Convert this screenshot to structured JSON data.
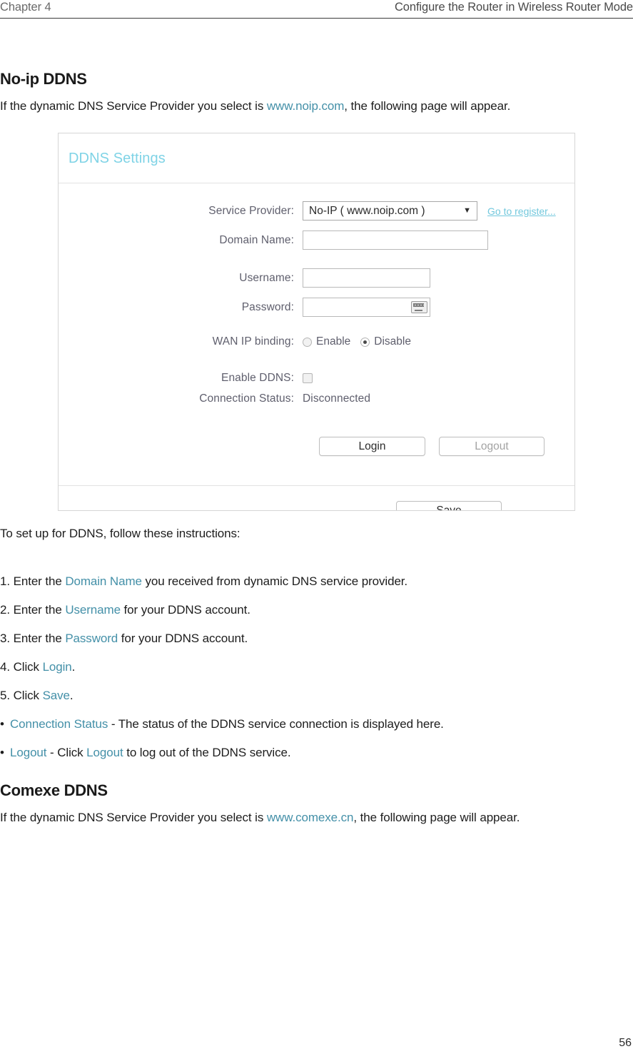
{
  "header": {
    "chapter": "Chapter 4",
    "doc_title": "Configure the Router in Wireless Router Mode"
  },
  "sections": [
    {
      "heading": "No-ip DDNS",
      "intro_before": "If the dynamic DNS Service Provider you select is ",
      "intro_link": "www.noip.com",
      "intro_after": ", the following page will appear."
    },
    {
      "heading": "Comexe DDNS",
      "intro_before": "If the dynamic DNS Service Provider you select is ",
      "intro_link": "www.comexe.cn",
      "intro_after": ", the following page will appear."
    }
  ],
  "screenshot_panel": {
    "title": "DDNS Settings",
    "fields": {
      "service_provider_label": "Service Provider:",
      "service_provider_value": "No-IP ( www.noip.com )",
      "service_provider_caret": "▼",
      "go_to_register": "Go to register...",
      "domain_name_label": "Domain Name:",
      "domain_name_value": "",
      "username_label": "Username:",
      "username_value": "",
      "password_label": "Password:",
      "password_value": "",
      "password_keyboard_icon": "keyboard-icon",
      "wan_ip_binding_label": "WAN IP binding:",
      "wan_ip_binding_enable": "Enable",
      "wan_ip_binding_disable": "Disable",
      "wan_ip_binding_selected": "Disable",
      "enable_ddns_label": "Enable DDNS:",
      "enable_ddns_checked": false,
      "connection_status_label": "Connection Status:",
      "connection_status_value": "Disconnected"
    },
    "buttons": {
      "login": "Login",
      "logout": "Logout",
      "save": "Save"
    },
    "colors": {
      "panel_title": "#7fd3e6",
      "label_text": "#5f5f6d",
      "link": "#72c8dd"
    }
  },
  "instructions": {
    "lead": "To set up for DDNS, follow these instructions:",
    "steps": [
      {
        "num": "1. Enter the ",
        "link": "Domain Name",
        "rest": " you received from dynamic DNS service provider."
      },
      {
        "num": "2. Enter the ",
        "link": "Username",
        "rest": " for your DDNS account."
      },
      {
        "num": "3. Enter the ",
        "link": "Password",
        "rest": " for your DDNS account."
      },
      {
        "num": "4. Click ",
        "link": "Login",
        "rest": "."
      },
      {
        "num": "5. Click ",
        "link": "Save",
        "rest": "."
      }
    ],
    "bullets": [
      {
        "term": "Connection Status",
        "mid": " - The status of the DDNS service connection is displayed here.",
        "link2": "",
        "tail": ""
      },
      {
        "term": "Logout",
        "mid": " - Click ",
        "link2": "Logout",
        "tail": " to log out of the DDNS service."
      }
    ]
  },
  "footer": {
    "page_number": "56"
  },
  "theme": {
    "link_color": "#4490a8",
    "text_color": "#1d1d1d"
  }
}
